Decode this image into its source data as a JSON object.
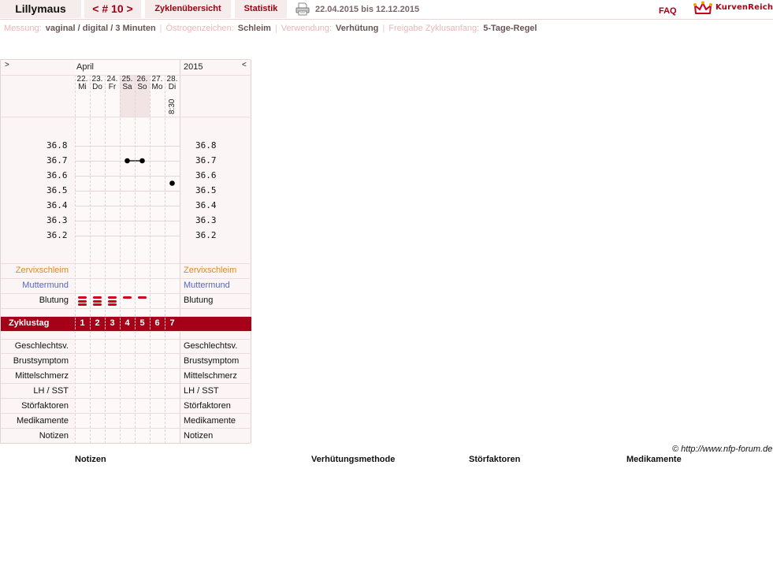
{
  "header": {
    "user_name": "Lillymaus",
    "cycle_nav": "< # 10 >",
    "tab_overview": "Zyklenübersicht",
    "tab_stats": "Statistik",
    "print_icon": "printer-icon",
    "date_range": "22.04.2015 bis 12.12.2015",
    "faq": "FAQ",
    "logo_text": "KurvenReich",
    "logo_icon": "crown-icon"
  },
  "info": {
    "measurement_label": "Messung:",
    "measurement_value": "vaginal / digital / 3 Minuten",
    "estrogen_label": "Östrogenzeichen:",
    "estrogen_value": "Schleim",
    "usage_label": "Verwendung:",
    "usage_value": "Verhütung",
    "release_label": "Freigabe Zyklusanfang:",
    "release_value": "5-Tage-Regel"
  },
  "chart": {
    "nav_prev": ">",
    "nav_next": "<",
    "month": "April",
    "year": "2015",
    "days": [
      {
        "date": "22.",
        "weekday": "Mi"
      },
      {
        "date": "23.",
        "weekday": "Do"
      },
      {
        "date": "24.",
        "weekday": "Fr"
      },
      {
        "date": "25.",
        "weekday": "Sa"
      },
      {
        "date": "26.",
        "weekday": "So"
      },
      {
        "date": "27.",
        "weekday": "Mo"
      },
      {
        "date": "28.",
        "weekday": "Di"
      }
    ],
    "time_last": "8:30",
    "temp_labels": [
      "36.8",
      "36.7",
      "36.6",
      "36.5",
      "36.4",
      "36.3",
      "36.2"
    ],
    "temperatures": [
      null,
      null,
      null,
      36.7,
      36.7,
      null,
      36.55
    ],
    "rows_mid": {
      "mucus": "Zervixschleim",
      "cervix": "Muttermund",
      "bleeding": "Blutung"
    },
    "bleeding_levels": [
      3,
      3,
      3,
      1,
      1,
      0,
      0
    ],
    "cycle_day_label": "Zyklustag",
    "cycle_days": [
      "1",
      "2",
      "3",
      "4",
      "5",
      "6",
      "7"
    ],
    "rows_bottom": [
      "Geschlechtsv.",
      "Brustsymptom",
      "Mittelschmerz",
      "LH / SST",
      "Störfaktoren",
      "Medikamente",
      "Notizen"
    ]
  },
  "footer": {
    "copyright": "© http://www.nfp-forum.de",
    "heads": [
      "Notizen",
      "Verhütungsmethode",
      "Störfaktoren",
      "Medikamente"
    ]
  },
  "colors": {
    "accent": "#a50018",
    "bleeding": "#d2001a",
    "mucus_label": "#e08a1e",
    "cervix_label": "#5566c4"
  }
}
